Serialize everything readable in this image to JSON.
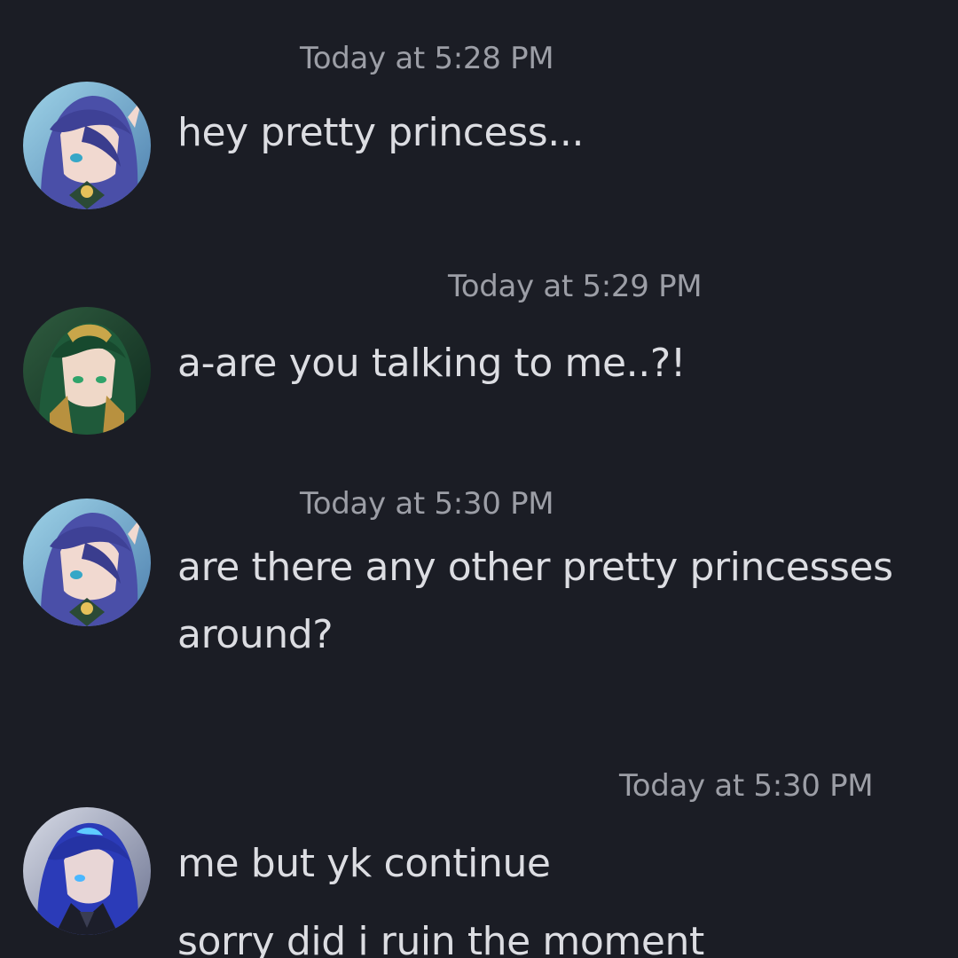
{
  "messages": [
    {
      "timestamp": "Today at 5:28 PM",
      "avatar_icon": "avatar-purple-hair-icon",
      "lines": [
        "hey pretty princess..."
      ]
    },
    {
      "timestamp": "Today at 5:29 PM",
      "avatar_icon": "avatar-green-hair-icon",
      "lines": [
        "a-are you talking to me..?!"
      ]
    },
    {
      "timestamp": "Today at 5:30 PM",
      "avatar_icon": "avatar-purple-hair-icon",
      "lines": [
        "are there any other pretty princesses",
        "around?"
      ]
    },
    {
      "timestamp": "Today at 5:30 PM",
      "avatar_icon": "avatar-blue-hair-icon",
      "lines": [
        "me but yk continue",
        "sorry did i ruin the moment"
      ]
    }
  ],
  "colors": {
    "background": "#1b1d25",
    "message_text": "#dcdde2",
    "timestamp_text": "#9c9ea6"
  }
}
